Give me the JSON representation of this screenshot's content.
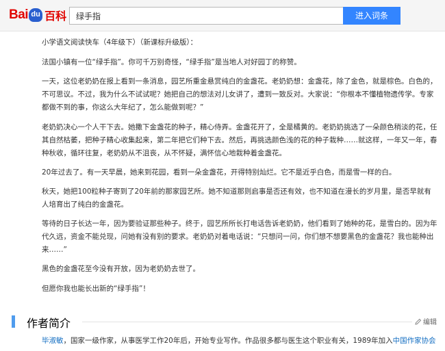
{
  "header": {
    "logo_bai": "Bai",
    "logo_paw": "du",
    "logo_baike": "百科",
    "search_value": "绿手指",
    "search_button": "进入词条"
  },
  "article": {
    "paragraphs": [
      "小学语文阅读快车（4年级下）（新课标升级版）：",
      "法国小镇有一位“绿手指”。你可千万别奇怪，“绿手指”是当地人对好园丁的称赞。",
      "一天，这位老奶奶在报上看到一条消息，园艺所重金悬赏纯白的金盏花。老奶奶想：金盏花，除了金色，就是棕色。白色的，不可思议。不过，我为什么不试试呢？她把自己的想法对儿女讲了，遭到一致反对。大家说：“你根本不懂植物遗传学。专家都做不到的事，你这么大年纪了，怎么能做到呢？”",
      "老奶奶决心一个人干下去。她撒下金盏花的种子，精心侍弄。金盏花开了，全是橘黄的。老奶奶挑选了一朵颜色稍淡的花，任其自然枯萎，把种子精心收集起来，第二年把它们种下去。然后，再挑选颜色浅的花的种子栽种……就这样，一年又一年，春种秋收，循环往复，老奶奶从不沮丧，从不怀疑，满怀信心地栽种着金盏花。",
      "20年过去了。有一天早晨，她来到花园，看到一朵金盏花，开得特别灿烂。它不是近乎白色，而是雪一样的白。",
      "秋天，她把100粒种子寄到了20年前的那家园艺所。她不知道那则启事是否还有效，也不知道在漫长的岁月里，是否早就有人培育出了纯白的金盏花。",
      "等待的日子长达一年，因为要验证那些种子。终于，园艺所所长打电话告诉老奶奶，他们看到了她种的花，是雪白的。因为年代久远，资金不能兑现，问她有没有别的要求。老奶奶对着电话说：“只想问一问，你们想不想要黑色的金盏花？我也能种出来……”",
      "黑色的金盏花至今没有开放，因为老奶奶去世了。",
      "但愿你我也能长出新的“绿手指”！"
    ]
  },
  "section": {
    "title": "作者简介",
    "edit_label": "编辑"
  },
  "author": {
    "name_link": "毕淑敏",
    "text_1": "，国家一级作家，从事医学工作20年后，开始专业写作。作品很多都与医生这个职业有关，1989年加入",
    "org_link": "中国作家协会"
  }
}
